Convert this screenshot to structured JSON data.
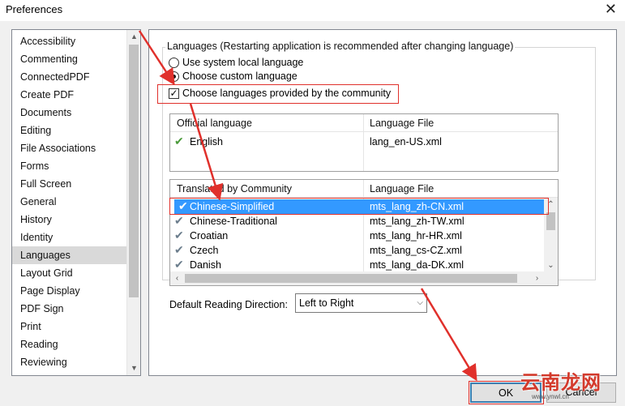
{
  "window": {
    "title": "Preferences",
    "close_glyph": "✕"
  },
  "sidebar": {
    "items": [
      {
        "label": "Accessibility"
      },
      {
        "label": "Commenting"
      },
      {
        "label": "ConnectedPDF"
      },
      {
        "label": "Create PDF"
      },
      {
        "label": "Documents"
      },
      {
        "label": "Editing"
      },
      {
        "label": "File Associations"
      },
      {
        "label": "Forms"
      },
      {
        "label": "Full Screen"
      },
      {
        "label": "General"
      },
      {
        "label": "History"
      },
      {
        "label": "Identity"
      },
      {
        "label": "Languages"
      },
      {
        "label": "Layout Grid"
      },
      {
        "label": "Page Display"
      },
      {
        "label": "PDF Sign"
      },
      {
        "label": "Print"
      },
      {
        "label": "Reading"
      },
      {
        "label": "Reviewing"
      }
    ],
    "selected": "Languages"
  },
  "languages": {
    "legend": "Languages (Restarting application is recommended after changing language)",
    "radio_system": "Use system local language",
    "radio_custom": "Choose custom language",
    "selected_radio": "Choose custom language",
    "checkbox_community": "Choose languages provided by the community",
    "checkbox_checked": true
  },
  "official_table": {
    "headers": [
      "Official language",
      "Language File"
    ],
    "rows": [
      {
        "language": "English",
        "file": "lang_en-US.xml"
      }
    ]
  },
  "community_table": {
    "headers": [
      "Translated by Community",
      "Language File"
    ],
    "rows": [
      {
        "language": "Chinese-Simplified",
        "file": "mts_lang_zh-CN.xml"
      },
      {
        "language": "Chinese-Traditional",
        "file": "mts_lang_zh-TW.xml"
      },
      {
        "language": "Croatian",
        "file": "mts_lang_hr-HR.xml"
      },
      {
        "language": "Czech",
        "file": "mts_lang_cs-CZ.xml"
      },
      {
        "language": "Danish",
        "file": "mts_lang_da-DK.xml"
      }
    ],
    "selected": "Chinese-Simplified"
  },
  "reading_direction": {
    "label": "Default Reading Direction:",
    "value": "Left to Right"
  },
  "buttons": {
    "ok": "OK",
    "cancel": "Cancel"
  },
  "watermark": {
    "text": "云南龙网",
    "url": "www.ynwl.cn"
  },
  "colors": {
    "annotation": "#e0302b",
    "selection": "#3399ff",
    "check_green": "#4a9a3a"
  }
}
